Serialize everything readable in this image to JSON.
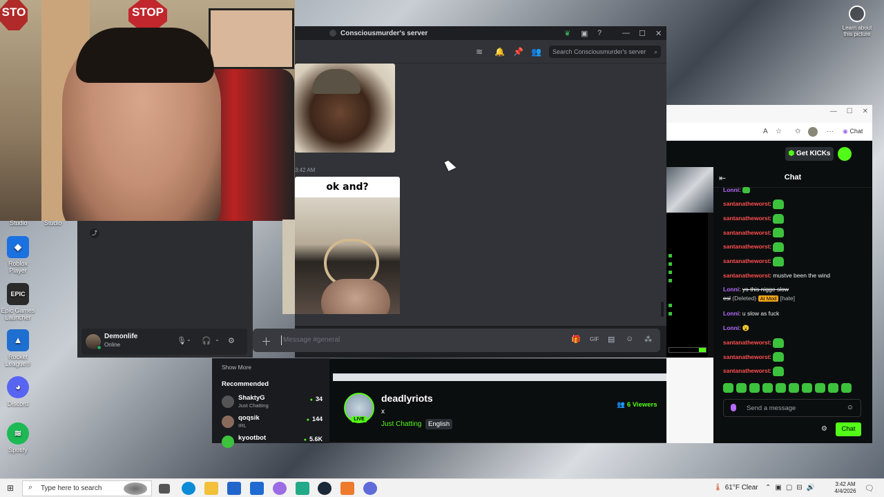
{
  "desktop": {
    "studio_labels": [
      "Studio",
      "Studio"
    ],
    "icons": [
      {
        "label": "Roblox Player",
        "icon": "roblox-icon",
        "color": "#1b71e0"
      },
      {
        "label": "Epic Games Launcher",
        "icon": "epic-games-icon",
        "color": "#2a2a2a"
      },
      {
        "label": "Rocket League®",
        "icon": "rocket-league-icon",
        "color": "#1e6fd0"
      },
      {
        "label": "Discord",
        "icon": "discord-icon",
        "color": "#5865f2"
      },
      {
        "label": "Spotify",
        "icon": "spotify-icon",
        "color": "#1db954"
      }
    ],
    "learn_about": "Learn about this picture"
  },
  "webcam": {
    "stop_sign": "STOP",
    "stop_sign_left": "STO"
  },
  "discord": {
    "window_title": "Consciousmurder's server",
    "search_placeholder": "Search Consciousmurder's server",
    "timestamp": "3:42 AM",
    "image_caption": "ok and?",
    "composer_placeholder": "Message #general",
    "user": {
      "name": "Demonlife",
      "status": "Online"
    }
  },
  "browser": {
    "copilot_label": "Chat"
  },
  "kick": {
    "get_kicks": "Get KICKs",
    "chat_title": "Chat",
    "messages": [
      {
        "user": "Lonni",
        "color": "purple",
        "text": "",
        "emote": true,
        "small": true
      },
      {
        "user": "santanatheworst",
        "color": "red",
        "text": "",
        "emote": true
      },
      {
        "user": "santanatheworst",
        "color": "red",
        "text": "",
        "emote": true
      },
      {
        "user": "santanatheworst",
        "color": "red",
        "text": "",
        "emote": true
      },
      {
        "user": "santanatheworst",
        "color": "red",
        "text": "",
        "emote": true
      },
      {
        "user": "santanatheworst",
        "color": "red",
        "text": "",
        "emote": true
      },
      {
        "user": "santanatheworst",
        "color": "red",
        "text": "mustve been the wind"
      },
      {
        "user": "Lonni",
        "color": "purple",
        "text": "yo this nigge slow",
        "strike": true
      },
      {
        "cont": "esl",
        "deleted": "(Deleted)",
        "badge": "AI Mod",
        "tag": "[hate]"
      },
      {
        "user": "Lonni",
        "color": "purple",
        "text": "u slow as fuck"
      },
      {
        "user": "Lonni",
        "color": "purple",
        "text": "😮"
      },
      {
        "user": "santanatheworst",
        "color": "red",
        "text": "",
        "emote": true
      },
      {
        "user": "santanatheworst",
        "color": "red",
        "text": "",
        "emote": true
      },
      {
        "user": "santanatheworst",
        "color": "red",
        "text": "",
        "emote": true
      }
    ],
    "send_placeholder": "Send a message",
    "chat_button": "Chat",
    "sidebar": {
      "show_more": "Show More",
      "recommended": "Recommended",
      "channels": [
        {
          "name": "ShaktyG",
          "category": "Just Chatting",
          "viewers": "34"
        },
        {
          "name": "qoqsik",
          "category": "IRL",
          "viewers": "144"
        },
        {
          "name": "kyootbot",
          "category": "",
          "viewers": "5.6K"
        }
      ]
    },
    "stream": {
      "streamer": "deadlyriots",
      "live": "LIVE",
      "title": "x",
      "category": "Just Chatting",
      "language": "English",
      "viewers": "6 Viewers"
    },
    "colors": {
      "accent": "#53fc18",
      "user_red": "#ff4f4f",
      "user_purple": "#b66bff"
    }
  },
  "taskbar": {
    "search_placeholder": "Type here to search",
    "weather": "61°F  Clear",
    "time": "3:42 AM",
    "date": "4/4/2026",
    "apps": [
      {
        "icon": "task-view-icon",
        "color": "#555"
      },
      {
        "icon": "edge-icon",
        "color": "#0c8bd7"
      },
      {
        "icon": "file-explorer-icon",
        "color": "#f2c03a"
      },
      {
        "icon": "store-icon",
        "color": "#2266cc"
      },
      {
        "icon": "outlook-icon",
        "color": "#1f6bd1"
      },
      {
        "icon": "copilot-icon",
        "color": "#9b6ce6"
      },
      {
        "icon": "discord-icon",
        "color": "#22aa88"
      },
      {
        "icon": "steam-icon",
        "color": "#1b2838"
      },
      {
        "icon": "sublime-icon",
        "color": "#ee7a2c"
      },
      {
        "icon": "chrome-icon",
        "color": "#5f6bd8"
      }
    ]
  }
}
